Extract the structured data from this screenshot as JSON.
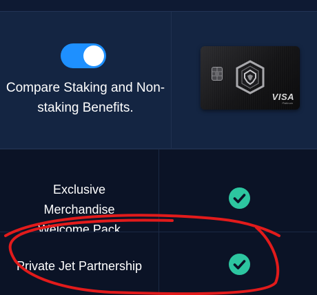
{
  "header": {
    "toggle_label": "Compare Staking and Non-staking Benefits.",
    "toggle_state": "on",
    "card": {
      "brand": "VISA",
      "tier": "Platinum",
      "logo_icon": "crypto-com-lion-icon",
      "chip_icon": "card-chip-icon"
    }
  },
  "benefits": [
    {
      "label": "Exclusive Merchandise Welcome Pack",
      "included": true,
      "icon": "check-circle-icon"
    },
    {
      "label": "Private Jet Partnership",
      "included": true,
      "icon": "check-circle-icon"
    }
  ],
  "colors": {
    "background": "#0b1326",
    "header_background": "#142542",
    "toggle_accent": "#1e90ff",
    "check_accent": "#2dc6a0",
    "annotation_stroke": "#e21b1b"
  }
}
